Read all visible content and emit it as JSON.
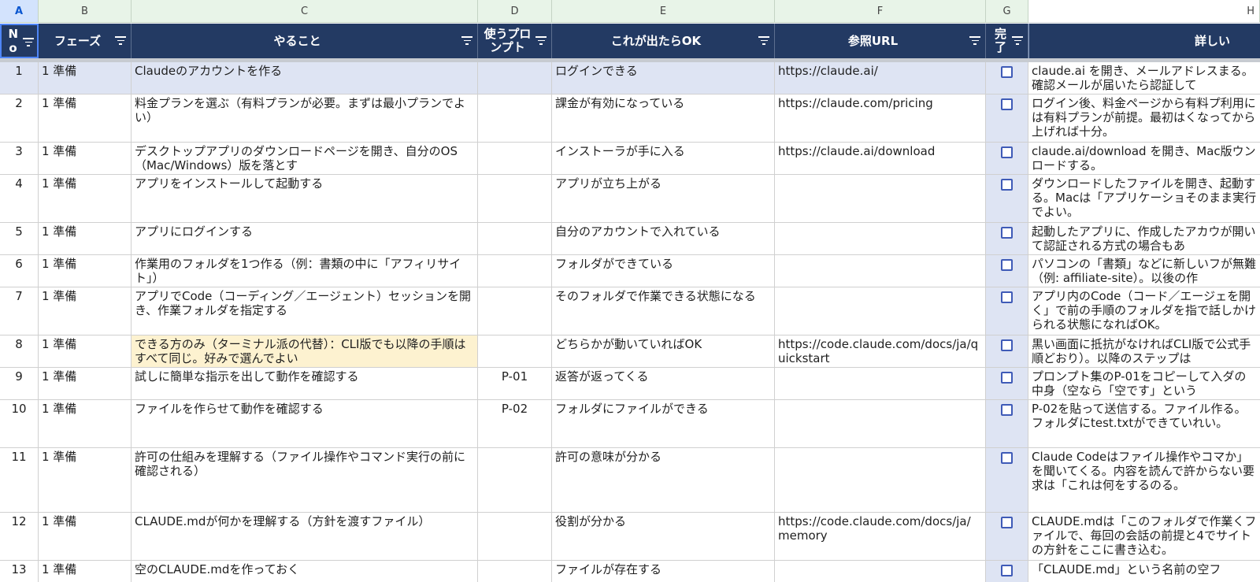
{
  "column_letters": [
    "A",
    "B",
    "C",
    "D",
    "E",
    "F",
    "G",
    "H"
  ],
  "headers": {
    "no": "No",
    "phase": "フェーズ",
    "task": "やること",
    "prompt": "使うプロンプト",
    "ok": "これが出たらOK",
    "url": "参照URL",
    "done": "完了",
    "detail": "詳しい"
  },
  "rows": [
    {
      "no": "1",
      "phase": "1 準備",
      "task": "Claudeのアカウントを作る",
      "prompt": "",
      "ok": "ログインできる",
      "url": "https://claude.ai/",
      "detail": "claude.ai を開き、メールアドレスまる。確認メールが届いたら認証して"
    },
    {
      "no": "2",
      "phase": "1 準備",
      "task": "料金プランを選ぶ（有料プランが必要。まずは最小プランでよい）",
      "prompt": "",
      "ok": "課金が有効になっている",
      "url": "https://claude.com/pricing",
      "detail": "ログイン後、料金ページから有料プ利用には有料プランが前提。最初はくなってから上げれば十分。"
    },
    {
      "no": "3",
      "phase": "1 準備",
      "task": "デスクトップアプリのダウンロードページを開き、自分のOS（Mac/Windows）版を落とす",
      "prompt": "",
      "ok": "インストーラが手に入る",
      "url": "https://claude.ai/download",
      "detail": "claude.ai/download を開き、Mac版ウンロードする。"
    },
    {
      "no": "4",
      "phase": "1 準備",
      "task": "アプリをインストールして起動する",
      "prompt": "",
      "ok": "アプリが立ち上がる",
      "url": "",
      "detail": "ダウンロードしたファイルを開き、起動する。Macは「アプリケーショそのまま実行でよい。"
    },
    {
      "no": "5",
      "phase": "1 準備",
      "task": "アプリにログインする",
      "prompt": "",
      "ok": "自分のアカウントで入れている",
      "url": "",
      "detail": "起動したアプリに、作成したアカウが開いて認証される方式の場合もあ"
    },
    {
      "no": "6",
      "phase": "1 準備",
      "task": "作業用のフォルダを1つ作る（例：書類の中に「アフィリサイト」）",
      "prompt": "",
      "ok": "フォルダができている",
      "url": "",
      "detail": "パソコンの「書類」などに新しいフが無難（例: affiliate-site）。以後の作"
    },
    {
      "no": "7",
      "phase": "1 準備",
      "task": "アプリでCode（コーディング／エージェント）セッションを開き、作業フォルダを指定する",
      "prompt": "",
      "ok": "そのフォルダで作業できる状態になる",
      "url": "",
      "detail": "アプリ内のCode（コード／エージェを開く」で前の手順のフォルダを指で話しかけられる状態になればOK。"
    },
    {
      "no": "8",
      "phase": "1 準備",
      "task": "できる方のみ（ターミナル派の代替）：CLI版でも以降の手順はすべて同じ。好みで選んでよい",
      "prompt": "",
      "ok": "どちらかが動いていればOK",
      "url": "https://code.claude.com/docs/ja/quickstart",
      "detail": "黒い画面に抵抗がなければCLI版で公式手順どおり）。以降のステップは"
    },
    {
      "no": "9",
      "phase": "1 準備",
      "task": "試しに簡単な指示を出して動作を確認する",
      "prompt": "P-01",
      "ok": "返答が返ってくる",
      "url": "",
      "detail": "プロンプト集のP-01をコピーして入ダの中身（空なら「空です」という"
    },
    {
      "no": "10",
      "phase": "1 準備",
      "task": "ファイルを作らせて動作を確認する",
      "prompt": "P-02",
      "ok": "フォルダにファイルができる",
      "url": "",
      "detail": "P-02を貼って送信する。ファイル作る。フォルダにtest.txtができていれい。"
    },
    {
      "no": "11",
      "phase": "1 準備",
      "task": "許可の仕組みを理解する（ファイル操作やコマンド実行の前に確認される）",
      "prompt": "",
      "ok": "許可の意味が分かる",
      "url": "",
      "detail": "Claude Codeはファイル操作やコマか」を聞いてくる。内容を読んで許からない要求は「これは何をするのる。"
    },
    {
      "no": "12",
      "phase": "1 準備",
      "task": "CLAUDE.mdが何かを理解する（方針を渡すファイル）",
      "prompt": "",
      "ok": "役割が分かる",
      "url": "https://code.claude.com/docs/ja/memory",
      "detail": "CLAUDE.mdは「このフォルダで作業くファイルで、毎回の会話の前提と4でサイトの方針をここに書き込む。"
    },
    {
      "no": "13",
      "phase": "1 準備",
      "task": "空のCLAUDE.mdを作っておく",
      "prompt": "",
      "ok": "ファイルが存在する",
      "url": "",
      "detail": "「CLAUDE.md」という名前の空フ"
    }
  ]
}
